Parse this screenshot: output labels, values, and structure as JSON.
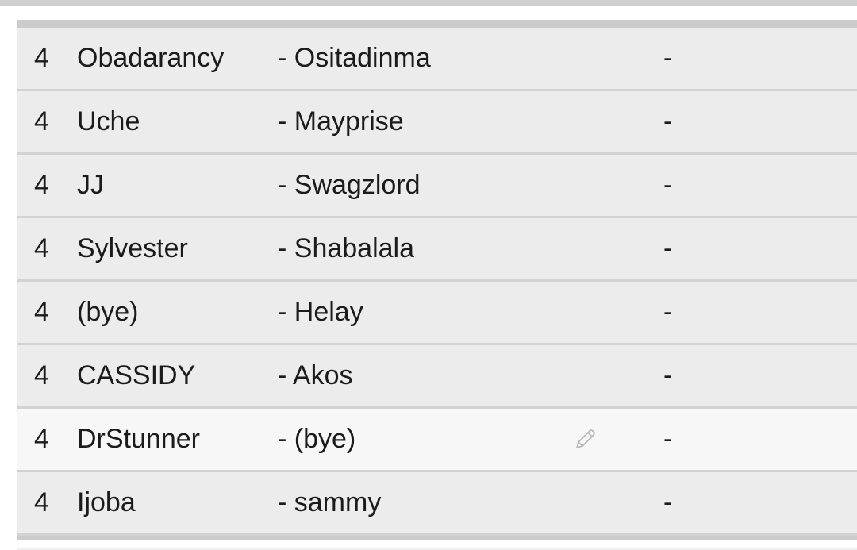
{
  "matches": [
    {
      "round": "4",
      "home": "Obadarancy",
      "away": "- Ositadinma",
      "score": "-",
      "editable": false
    },
    {
      "round": "4",
      "home": "Uche",
      "away": "- Mayprise",
      "score": "-",
      "editable": false
    },
    {
      "round": "4",
      "home": "JJ",
      "away": "- Swagzlord",
      "score": "-",
      "editable": false
    },
    {
      "round": "4",
      "home": "Sylvester",
      "away": "- Shabalala",
      "score": "-",
      "editable": false
    },
    {
      "round": "4",
      "home": "(bye)",
      "away": "- Helay",
      "score": "-",
      "editable": false
    },
    {
      "round": "4",
      "home": "CASSIDY",
      "away": "- Akos",
      "score": "-",
      "editable": false
    },
    {
      "round": "4",
      "home": "DrStunner",
      "away": "- (bye)",
      "score": "-",
      "editable": true
    },
    {
      "round": "4",
      "home": "Ijoba",
      "away": "- sammy",
      "score": "-",
      "editable": false
    }
  ],
  "icons": {
    "edit": "pencil-icon"
  },
  "colors": {
    "row_background": "#ececec",
    "row_highlight": "#f7f7f7",
    "divider": "#d2d2d2",
    "text": "#1b1b1b",
    "icon": "#b5b5b5"
  }
}
